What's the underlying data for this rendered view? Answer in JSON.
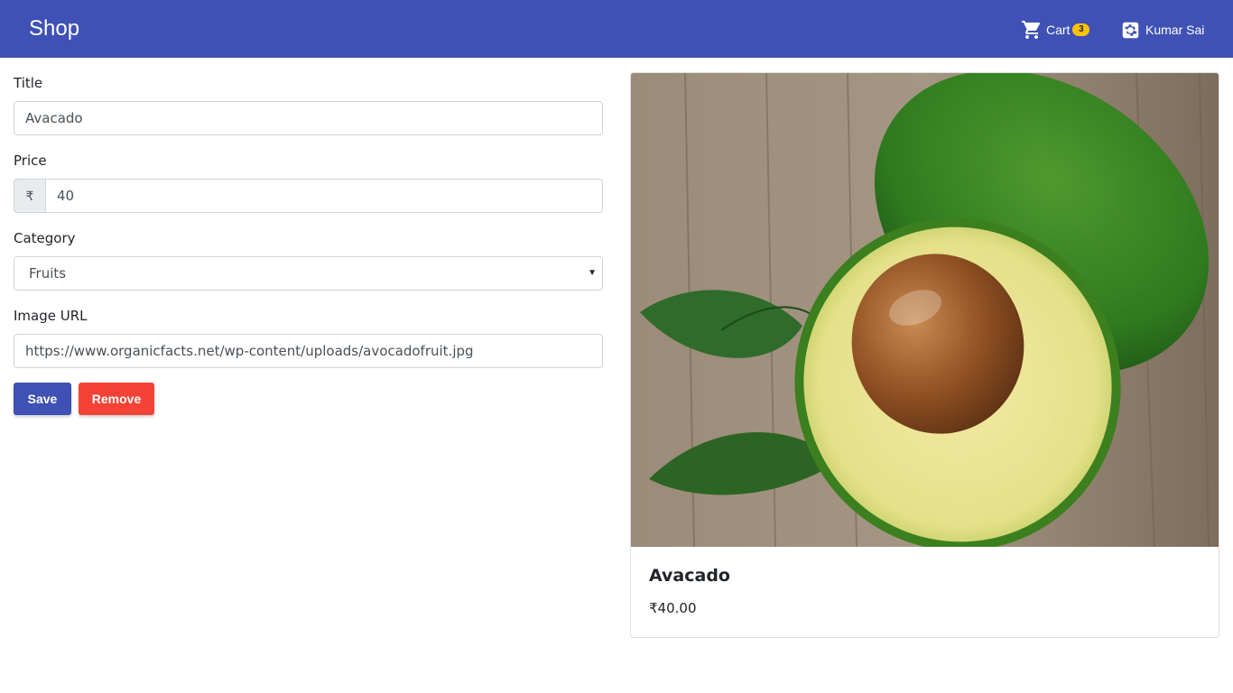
{
  "navbar": {
    "brand": "Shop",
    "cart_label": "Cart",
    "cart_count": "3",
    "user_name": "Kumar Sai"
  },
  "form": {
    "title_label": "Title",
    "title_value": "Avacado",
    "price_label": "Price",
    "currency_symbol": "₹",
    "price_value": "40",
    "category_label": "Category",
    "category_value": "Fruits",
    "image_url_label": "Image URL",
    "image_url_value": "https://www.organicfacts.net/wp-content/uploads/avocadofruit.jpg",
    "save_label": "Save",
    "remove_label": "Remove"
  },
  "preview": {
    "title": "Avacado",
    "price": "₹40.00"
  },
  "colors": {
    "primary": "#3f51b5",
    "danger": "#f44336",
    "badge": "#ffc107"
  },
  "icons": {
    "cart": "shopping-cart-icon",
    "user": "settings-icon",
    "select": "caret-down-icon"
  }
}
